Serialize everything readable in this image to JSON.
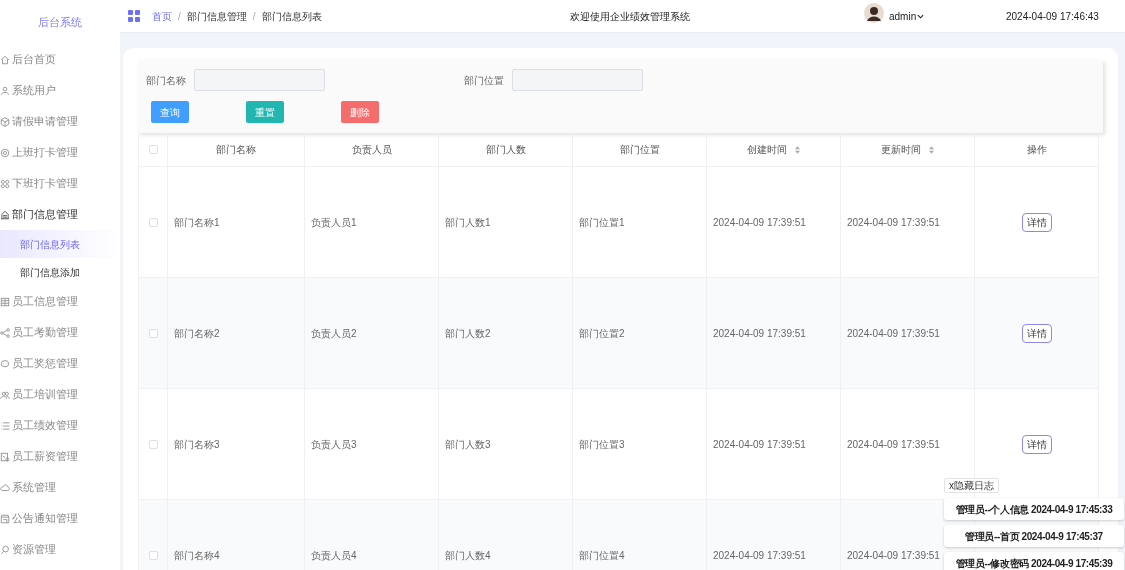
{
  "sidebar": {
    "title": "后台系统",
    "items": [
      {
        "label": "后台首页",
        "expanded": false
      },
      {
        "label": "系统用户",
        "expanded": false
      },
      {
        "label": "请假申请管理",
        "expanded": false
      },
      {
        "label": "上班打卡管理",
        "expanded": false
      },
      {
        "label": "下班打卡管理",
        "expanded": false
      },
      {
        "label": "部门信息管理",
        "expanded": true,
        "children": [
          {
            "label": "部门信息列表",
            "selected": true
          },
          {
            "label": "部门信息添加",
            "selected": false
          }
        ]
      },
      {
        "label": "员工信息管理",
        "expanded": false
      },
      {
        "label": "员工考勤管理",
        "expanded": false
      },
      {
        "label": "员工奖惩管理",
        "expanded": false
      },
      {
        "label": "员工培训管理",
        "expanded": false
      },
      {
        "label": "员工绩效管理",
        "expanded": false
      },
      {
        "label": "员工薪资管理",
        "expanded": false
      },
      {
        "label": "系统管理",
        "expanded": false
      },
      {
        "label": "公告通知管理",
        "expanded": false
      },
      {
        "label": "资源管理",
        "expanded": false
      }
    ]
  },
  "header": {
    "breadcrumb": [
      {
        "kind": "link",
        "text": "首页"
      },
      {
        "kind": "separator",
        "text": "/"
      },
      {
        "kind": "link",
        "text": "部门信息管理"
      },
      {
        "kind": "separator",
        "text": "/"
      },
      {
        "kind": "current",
        "text": "部门信息列表"
      }
    ],
    "welcome": "欢迎使用企业绩效管理系统",
    "user": "admin",
    "datetime": "2024-04-09 17:46:43"
  },
  "search": {
    "fields": [
      {
        "label": "部门名称"
      },
      {
        "label": "部门位置"
      }
    ],
    "buttons": [
      {
        "label": "查询",
        "kind": "query"
      },
      {
        "label": "重置",
        "kind": "reset"
      },
      {
        "label": "删除",
        "kind": "delete"
      }
    ]
  },
  "table": {
    "select_all_checked": false,
    "columns": [
      {
        "label": "部门名称",
        "sortable": false
      },
      {
        "label": "负责人员",
        "sortable": false
      },
      {
        "label": "部门人数",
        "sortable": false
      },
      {
        "label": "部门位置",
        "sortable": false
      },
      {
        "label": "创建时间",
        "sortable": true
      },
      {
        "label": "更新时间",
        "sortable": true
      },
      {
        "label": "操作",
        "sortable": false
      }
    ],
    "rows": [
      {
        "checked": false,
        "cells": [
          "部门名称1",
          "负责人员1",
          "部门人数1",
          "部门位置1",
          "2024-04-09 17:39:51",
          "2024-04-09 17:39:51"
        ],
        "action": "详情"
      },
      {
        "checked": false,
        "cells": [
          "部门名称2",
          "负责人员2",
          "部门人数2",
          "部门位置2",
          "2024-04-09 17:39:51",
          "2024-04-09 17:39:51"
        ],
        "action": "详情"
      },
      {
        "checked": false,
        "cells": [
          "部门名称3",
          "负责人员3",
          "部门人数3",
          "部门位置3",
          "2024-04-09 17:39:51",
          "2024-04-09 17:39:51"
        ],
        "action": "详情"
      },
      {
        "checked": false,
        "cells": [
          "部门名称4",
          "负责人员4",
          "部门人数4",
          "部门位置4",
          "2024-04-09 17:39:51",
          "2024-04-09 17:39:51"
        ]
      }
    ]
  },
  "log": {
    "hide_button": "x隐藏日志",
    "entries": [
      "管理员--个人信息 2024-04-9 17:45:33",
      "管理员--首页 2024-04-9 17:45:37",
      "管理员--修改密码 2024-04-9 17:45:39"
    ]
  }
}
